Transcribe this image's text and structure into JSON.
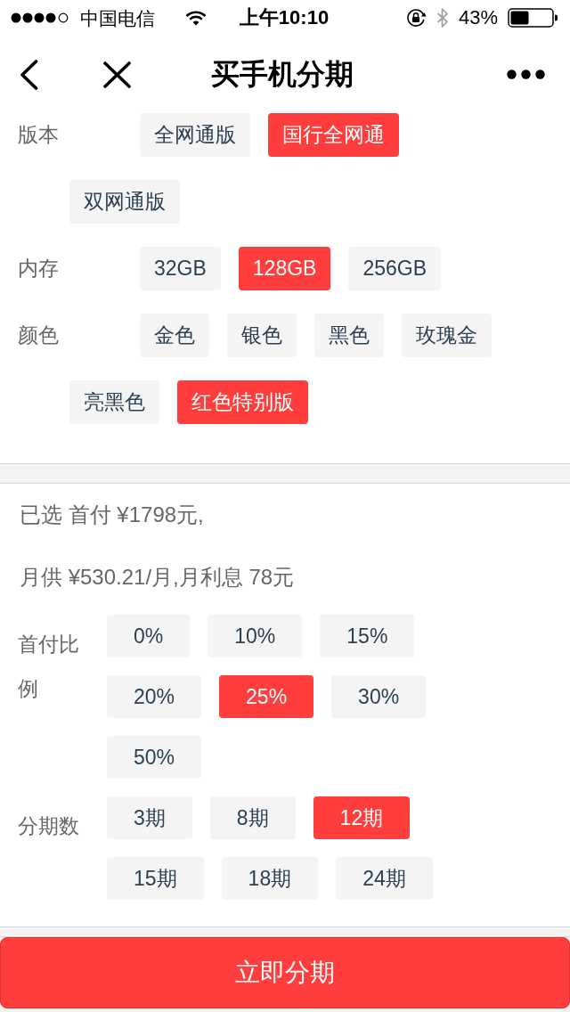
{
  "status_bar": {
    "carrier": "中国电信",
    "time": "上午10:10",
    "battery": "43%"
  },
  "nav": {
    "title": "买手机分期"
  },
  "specs": [
    {
      "label": "版本",
      "options": [
        {
          "label": "全网通版",
          "selected": false
        },
        {
          "label": "国行全网通",
          "selected": true
        },
        {
          "label": "双网通版",
          "selected": false
        }
      ]
    },
    {
      "label": "内存",
      "options": [
        {
          "label": "32GB",
          "selected": false
        },
        {
          "label": "128GB",
          "selected": true
        },
        {
          "label": "256GB",
          "selected": false
        }
      ]
    },
    {
      "label": "颜色",
      "options": [
        {
          "label": "金色",
          "selected": false
        },
        {
          "label": "银色",
          "selected": false
        },
        {
          "label": "黑色",
          "selected": false
        },
        {
          "label": "玫瑰金",
          "selected": false
        },
        {
          "label": "亮黑色",
          "selected": false
        },
        {
          "label": "红色特别版",
          "selected": true
        }
      ]
    }
  ],
  "plan": {
    "summary": [
      "已选 首付 ¥1798元,",
      "月供 ¥530.21/月,月利息 78元"
    ],
    "groups": [
      {
        "label": "首付比例",
        "options": [
          {
            "label": "0%",
            "selected": false
          },
          {
            "label": "10%",
            "selected": false
          },
          {
            "label": "15%",
            "selected": false
          },
          {
            "label": "20%",
            "selected": false
          },
          {
            "label": "25%",
            "selected": true
          },
          {
            "label": "30%",
            "selected": false
          },
          {
            "label": "50%",
            "selected": false
          }
        ]
      },
      {
        "label": "分期数",
        "options": [
          {
            "label": "3期",
            "selected": false
          },
          {
            "label": "8期",
            "selected": false
          },
          {
            "label": "12期",
            "selected": true
          },
          {
            "label": "15期",
            "selected": false
          },
          {
            "label": "18期",
            "selected": false
          },
          {
            "label": "24期",
            "selected": false
          }
        ]
      }
    ]
  },
  "action": {
    "label": "立即分期"
  }
}
